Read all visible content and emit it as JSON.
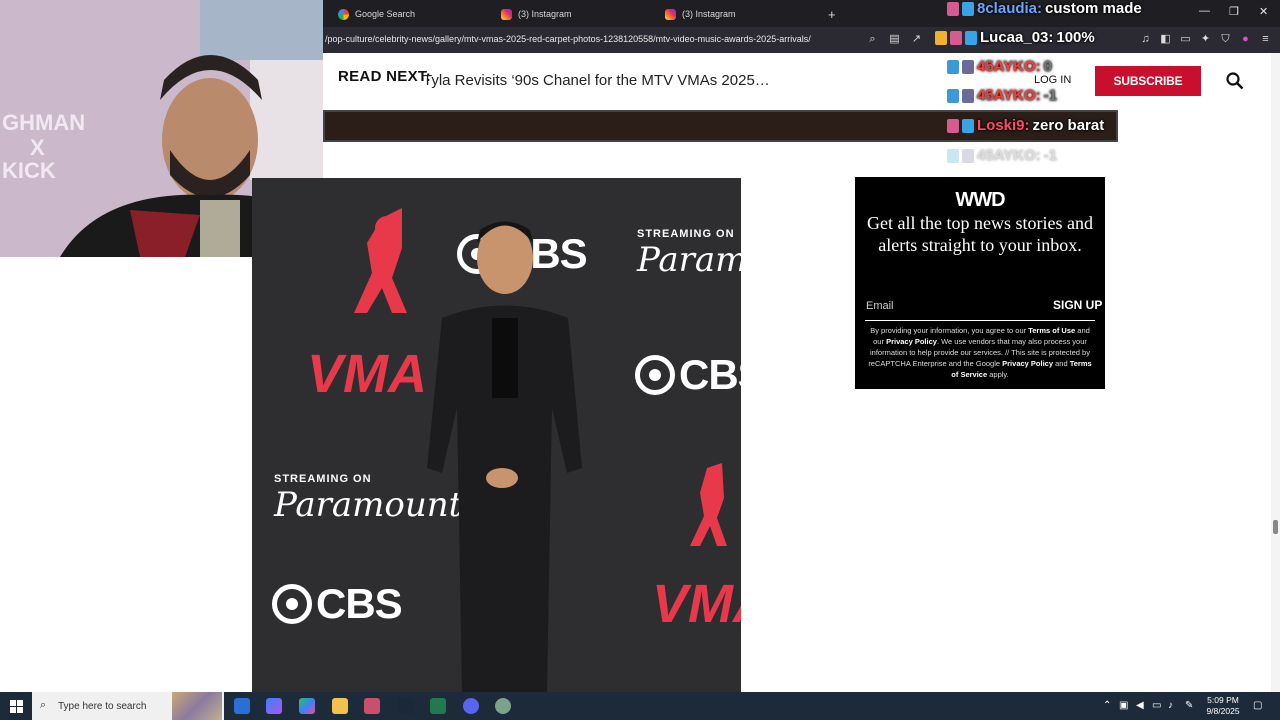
{
  "browser": {
    "tabs": [
      {
        "label": "Google Search",
        "icon": "google-icon"
      },
      {
        "label": "(3) Instagram",
        "icon": "instagram-icon"
      },
      {
        "label": "(3) Instagram",
        "icon": "instagram-icon"
      }
    ],
    "new_tab": "+",
    "url": "/pop-culture/celebrity-news/gallery/mtv-vmas-2025-red-carpet-photos-1238120558/mtv-video-music-awards-2025-arrivals/"
  },
  "overlay": {
    "chat": [
      {
        "user": "8claudia:",
        "msg": "custom made",
        "color": "#6aa6ff"
      },
      {
        "user": "Lucaa_03:",
        "msg": "100%",
        "color": "#ffffff"
      },
      {
        "user": "45AYKO:",
        "msg": "0",
        "color": "#ff3b3b"
      },
      {
        "user": "45AYKO:",
        "msg": "-1",
        "color": "#ff3b3b"
      },
      {
        "user": "Loski9:",
        "msg": "zero barat",
        "color": "#ff4a6a"
      },
      {
        "user": "45AYKO:",
        "msg": "-1",
        "color": "#ff3b3b"
      }
    ],
    "webcam_text": "GHMAN\nX\nKICK"
  },
  "header": {
    "read_next_label": "READ NEXT:",
    "read_next_title": "Tyla Revisits ‘90s Chanel for the MTV VMAs 2025…",
    "login": "LOG IN",
    "subscribe": "SUBSCRIBE"
  },
  "photo": {
    "cbs": "CBS",
    "streaming_on": "STREAMING ON",
    "paramount": "Paramount+",
    "vma": "VMA"
  },
  "newsletter": {
    "brand": "WWD",
    "headline": "Get all the top news stories and alerts straight to your inbox.",
    "email_placeholder": "Email",
    "signup": "SIGN UP",
    "legal_1": "By providing your information, you agree to our ",
    "terms": "Terms of Use",
    "legal_2": " and our ",
    "privacy": "Privacy Policy",
    "legal_3": ". We use vendors that may also process your information to help provide our services. // This site is protected by reCAPTCHA Enterprise and the Google ",
    "privacy2": "Privacy Policy",
    "legal_4": " and ",
    "tos": "Terms of Service",
    "legal_5": " apply."
  },
  "taskbar": {
    "search_placeholder": "Type here to search",
    "time": "5:09 PM",
    "date": "9/8/2025"
  }
}
